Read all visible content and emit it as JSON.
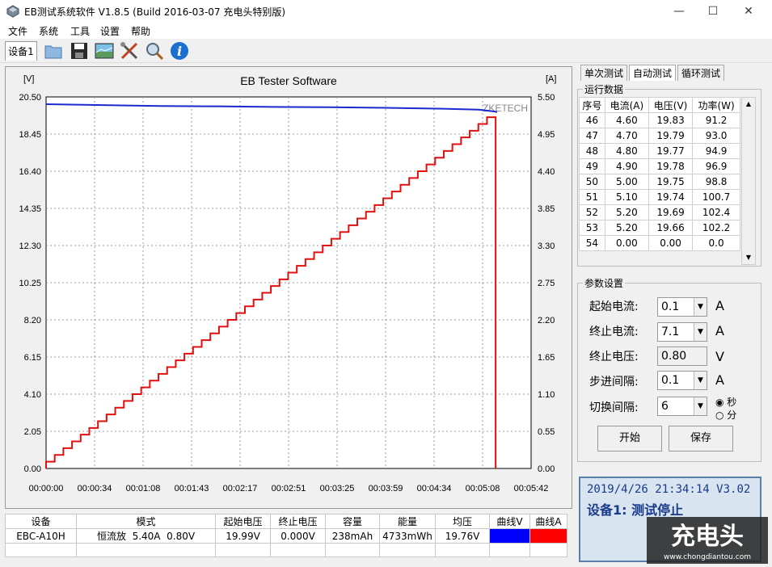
{
  "window": {
    "title": "EB测试系统软件 V1.8.5 (Build 2016-03-07 充电头特别版)",
    "minimize": "—",
    "maximize": "☐",
    "close": "✕"
  },
  "menu": [
    "文件",
    "系统",
    "工具",
    "设置",
    "帮助"
  ],
  "toolbar": {
    "device_tab": "设备1",
    "icons": [
      "folder-icon",
      "save-icon",
      "chart-icon",
      "tools-icon",
      "search-icon",
      "info-icon"
    ]
  },
  "chart_data": {
    "type": "line",
    "title": "EB Tester Software",
    "ylabel_left": "[V]",
    "ylabel_right": "[A]",
    "watermark": "ZKETECH",
    "y_left_ticks": [
      "20.50",
      "18.45",
      "16.40",
      "14.35",
      "12.30",
      "10.25",
      "8.20",
      "6.15",
      "4.10",
      "2.05",
      "0.00"
    ],
    "y_right_ticks": [
      "5.50",
      "4.95",
      "4.40",
      "3.85",
      "3.30",
      "2.75",
      "2.20",
      "1.65",
      "1.10",
      "0.55",
      "0.00"
    ],
    "x_ticks": [
      "00:00:00",
      "00:00:34",
      "00:01:08",
      "00:01:43",
      "00:02:17",
      "00:02:51",
      "00:03:25",
      "00:03:59",
      "00:04:34",
      "00:05:08",
      "00:05:42"
    ],
    "ylim_left": [
      0,
      20.5
    ],
    "ylim_right": [
      0,
      5.5
    ],
    "xlim_seconds": [
      0,
      342
    ],
    "series": [
      {
        "name": "Voltage",
        "color": "#1a2ad0",
        "axis": "left",
        "x": [
          0,
          40,
          80,
          120,
          160,
          200,
          240,
          280,
          305,
          316,
          318
        ],
        "values": [
          20.1,
          20.05,
          20.0,
          19.98,
          19.95,
          19.93,
          19.9,
          19.85,
          19.8,
          19.7,
          19.66
        ]
      },
      {
        "name": "Current",
        "color": "#e01010",
        "axis": "right",
        "stepped": true,
        "start": 0.1,
        "step": 0.1,
        "end": 5.2,
        "cutoff_x": 317
      }
    ],
    "grid": true
  },
  "right_tabs": [
    "单次测试",
    "自动测试",
    "循环测试"
  ],
  "run_data": {
    "label": "运行数据",
    "headers": [
      "序号",
      "电流(A)",
      "电压(V)",
      "功率(W)"
    ],
    "rows": [
      [
        "46",
        "4.60",
        "19.83",
        "91.2"
      ],
      [
        "47",
        "4.70",
        "19.79",
        "93.0"
      ],
      [
        "48",
        "4.80",
        "19.77",
        "94.9"
      ],
      [
        "49",
        "4.90",
        "19.78",
        "96.9"
      ],
      [
        "50",
        "5.00",
        "19.75",
        "98.8"
      ],
      [
        "51",
        "5.10",
        "19.74",
        "100.7"
      ],
      [
        "52",
        "5.20",
        "19.69",
        "102.4"
      ],
      [
        "53",
        "5.20",
        "19.66",
        "102.2"
      ],
      [
        "54",
        "0.00",
        "0.00",
        "0.0"
      ]
    ]
  },
  "params": {
    "label": "参数设置",
    "start_current_label": "起始电流:",
    "start_current": "0.1",
    "start_current_unit": "A",
    "end_current_label": "终止电流:",
    "end_current": "7.1",
    "end_current_unit": "A",
    "end_voltage_label": "终止电压:",
    "end_voltage": "0.80",
    "end_voltage_unit": "V",
    "step_label": "步进间隔:",
    "step": "0.1",
    "step_unit": "A",
    "switch_label": "切换间隔:",
    "switch": "6",
    "unit_sec": "秒",
    "unit_min": "分",
    "start_button": "开始",
    "save_button": "保存"
  },
  "status": {
    "datetime": "2019/4/26 21:34:14",
    "version": "V3.02",
    "message": "设备1: 测试停止"
  },
  "bottom_table": {
    "headers": [
      "设备",
      "模式",
      "起始电压",
      "终止电压",
      "容量",
      "能量",
      "均压",
      "曲线V",
      "曲线A"
    ],
    "row": [
      "EBC-A10H",
      "恒流放  5.40A  0.80V",
      "19.99V",
      "0.000V",
      "238mAh",
      "4733mWh",
      "19.76V",
      "",
      ""
    ],
    "curve_v_color": "#0000ff",
    "curve_a_color": "#ff0000"
  },
  "watermark_site": "www.chongdiantou.com"
}
